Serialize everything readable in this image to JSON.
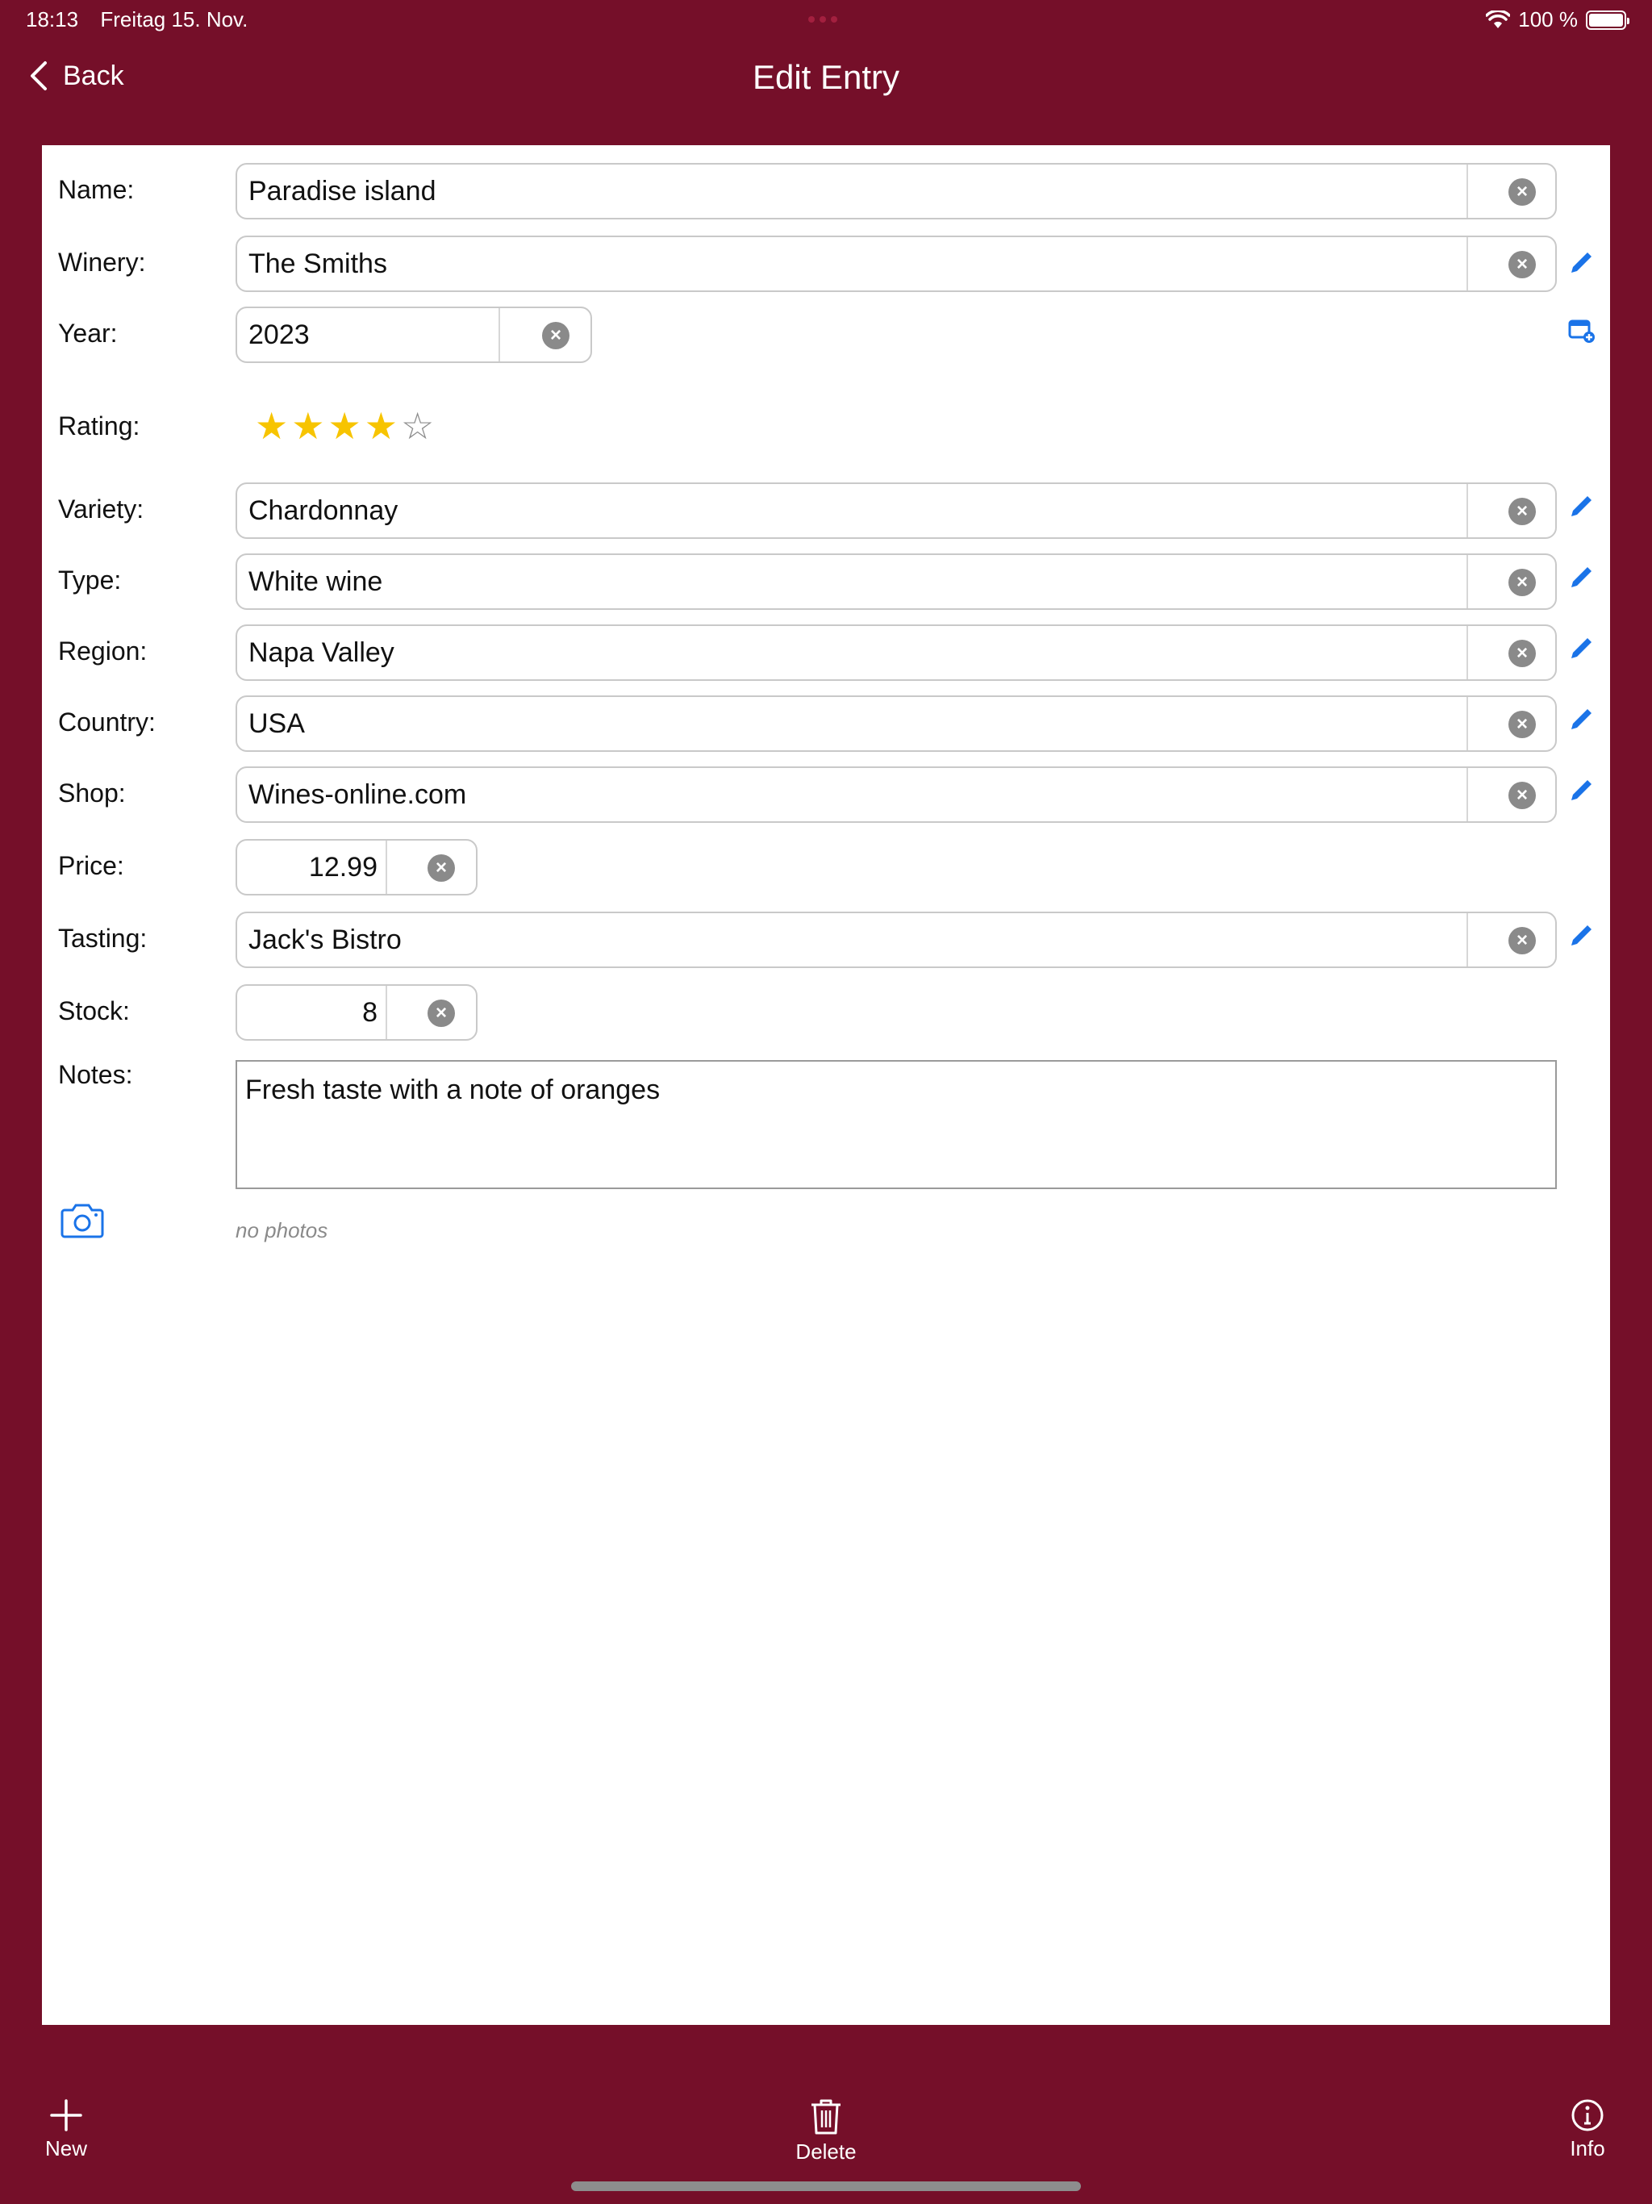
{
  "status": {
    "time": "18:13",
    "date": "Freitag 15. Nov.",
    "battery": "100 %"
  },
  "nav": {
    "back_label": "Back",
    "title": "Edit Entry"
  },
  "form": {
    "name": {
      "label": "Name:",
      "value": "Paradise island"
    },
    "winery": {
      "label": "Winery:",
      "value": "The Smiths"
    },
    "year": {
      "label": "Year:",
      "value": "2023"
    },
    "rating": {
      "label": "Rating:",
      "value": 4,
      "max": 5
    },
    "variety": {
      "label": "Variety:",
      "value": "Chardonnay"
    },
    "type": {
      "label": "Type:",
      "value": "White wine"
    },
    "region": {
      "label": "Region:",
      "value": "Napa Valley"
    },
    "country": {
      "label": "Country:",
      "value": "USA"
    },
    "shop": {
      "label": "Shop:",
      "value": "Wines-online.com"
    },
    "price": {
      "label": "Price:",
      "value": "12.99"
    },
    "tasting": {
      "label": "Tasting:",
      "value": "Jack's Bistro"
    },
    "stock": {
      "label": "Stock:",
      "value": "8"
    },
    "notes": {
      "label": "Notes:",
      "value": "Fresh taste with a note of oranges"
    },
    "photos": {
      "empty_text": "no photos"
    }
  },
  "toolbar": {
    "new_label": "New",
    "delete_label": "Delete",
    "info_label": "Info"
  },
  "colors": {
    "background": "#750f29",
    "accent": "#1a73e8",
    "star": "#f7c400",
    "clear": "#8a8a8a"
  },
  "icons": [
    "chevron-left-icon",
    "clear-icon",
    "pencil-icon",
    "calendar-add-icon",
    "camera-icon",
    "plus-icon",
    "trash-icon",
    "info-icon",
    "wifi-icon",
    "battery-icon"
  ]
}
